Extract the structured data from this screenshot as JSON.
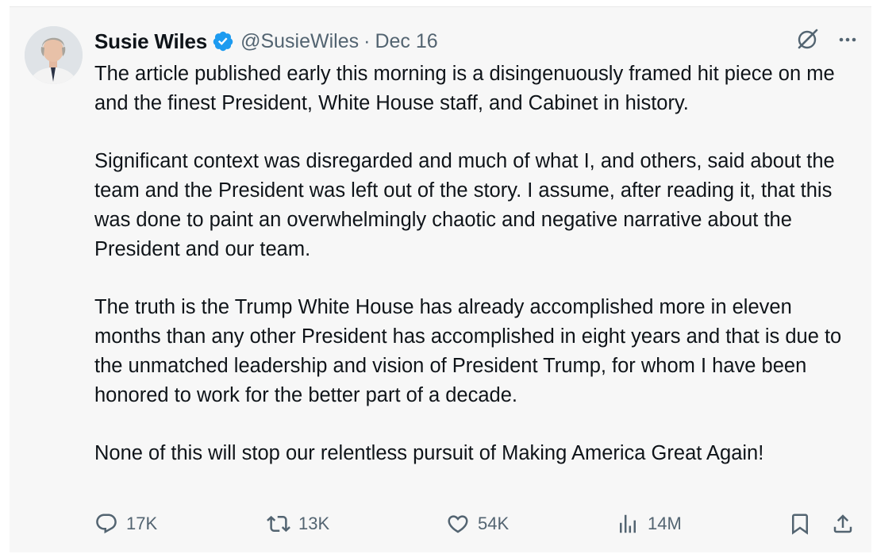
{
  "tweet": {
    "author_name": "Susie Wiles",
    "handle": "@SusieWiles",
    "separator": "·",
    "date": "Dec 16",
    "paragraphs": [
      "The article published early this morning is a disingenuously framed hit piece on me and the finest President, White House staff, and Cabinet in history.",
      "Significant context was disregarded and much of what I, and others, said about the team and the President was left out of the story. I assume, after reading it, that this was done to paint an overwhelmingly chaotic and negative narrative about the President and our team.",
      "The truth is the Trump White House has already accomplished more in eleven months than any other President has accomplished in eight years and that is due to the unmatched leadership and vision of President Trump, for whom I have been honored to work for the better part of a decade.",
      "None of this will stop our relentless pursuit of Making America Great Again!"
    ]
  },
  "metrics": {
    "replies": "17K",
    "reposts": "13K",
    "likes": "54K",
    "views": "14M"
  },
  "icons": {
    "verified": "verified-badge-icon",
    "grok": "grok-icon",
    "more": "more-icon",
    "reply": "reply-icon",
    "repost": "repost-icon",
    "like": "like-icon",
    "views": "views-icon",
    "bookmark": "bookmark-icon",
    "share": "share-icon"
  },
  "colors": {
    "background": "#f7f7f7",
    "text": "#0f1419",
    "secondary": "#536471",
    "verified": "#1d9bf0"
  }
}
